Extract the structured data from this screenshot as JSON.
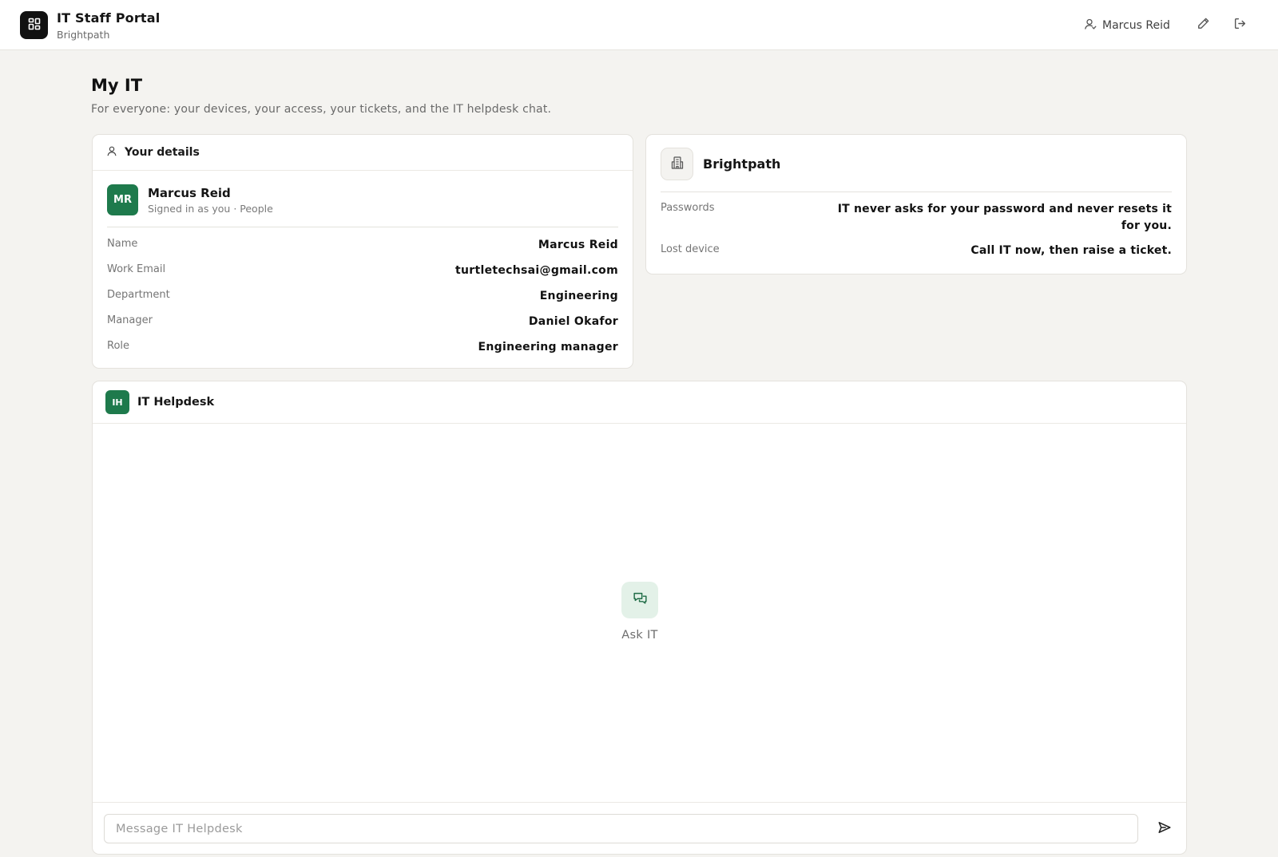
{
  "header": {
    "app_title": "IT Staff Portal",
    "org_subtitle": "Brightpath",
    "user_name": "Marcus Reid",
    "icons": [
      "grid-icon",
      "user-icon",
      "pencil-icon",
      "logout-icon"
    ]
  },
  "page": {
    "title": "My IT",
    "subtitle": "For everyone: your devices, your access, your tickets, and the IT helpdesk chat."
  },
  "details": {
    "heading": "Your details",
    "avatar_initials": "MR",
    "name": "Marcus Reid",
    "signed_in": "Signed in as you · People",
    "rows": [
      {
        "label": "Name",
        "value": "Marcus Reid"
      },
      {
        "label": "Work Email",
        "value": "turtletechsai@gmail.com"
      },
      {
        "label": "Department",
        "value": "Engineering"
      },
      {
        "label": "Manager",
        "value": "Daniel Okafor"
      },
      {
        "label": "Role",
        "value": "Engineering manager"
      }
    ]
  },
  "org": {
    "name": "Brightpath",
    "policies": [
      {
        "label": "Passwords",
        "value": "IT never asks for your password and never resets it for you."
      },
      {
        "label": "Lost device",
        "value": "Call IT now, then raise a ticket."
      }
    ]
  },
  "helpdesk": {
    "avatar_initials": "IH",
    "title": "IT Helpdesk",
    "empty_label": "Ask IT",
    "input_placeholder": "Message IT Helpdesk"
  },
  "colors": {
    "accent_green": "#1e7a4c",
    "background": "#f4f3f0",
    "logo_bg": "#111111"
  }
}
